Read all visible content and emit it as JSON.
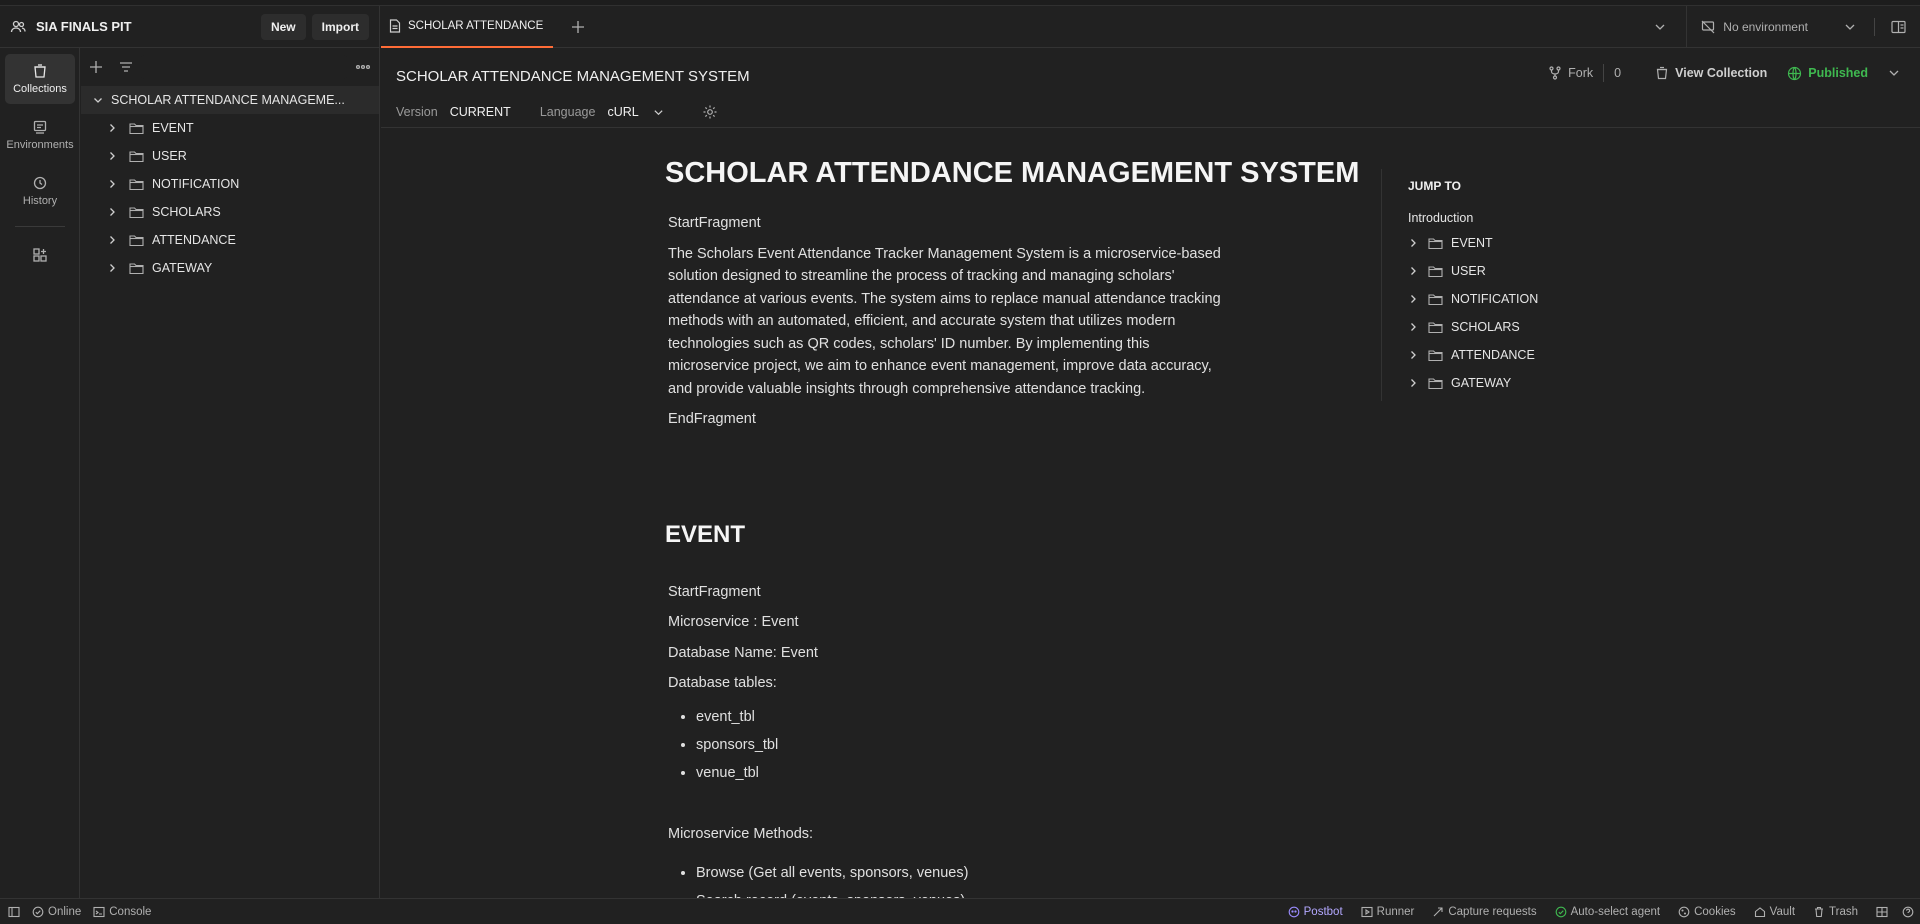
{
  "workspace": {
    "name": "SIA FINALS PIT",
    "new_label": "New",
    "import_label": "Import"
  },
  "rail": [
    {
      "label": "Collections",
      "icon": "collections-icon"
    },
    {
      "label": "Environments",
      "icon": "environments-icon"
    },
    {
      "label": "History",
      "icon": "history-icon"
    }
  ],
  "tree": {
    "root": "SCHOLAR ATTENDANCE MANAGEME...",
    "folders": [
      "EVENT",
      "USER",
      "NOTIFICATION",
      "SCHOLARS",
      "ATTENDANCE",
      "GATEWAY"
    ]
  },
  "tab": {
    "label": "SCHOLAR ATTENDANCE"
  },
  "environment": {
    "label": "No environment"
  },
  "collection": {
    "title": "SCHOLAR ATTENDANCE MANAGEMENT SYSTEM",
    "version_key": "Version",
    "version_value": "CURRENT",
    "language_key": "Language",
    "language_value": "cURL",
    "fork_label": "Fork",
    "fork_count": "0",
    "view_label": "View Collection",
    "published_label": "Published"
  },
  "doc": {
    "title": "SCHOLAR ATTENDANCE MANAGEMENT SYSTEM",
    "start1": "StartFragment",
    "intro": "The Scholars Event Attendance Tracker Management System is a microservice-based solution designed to streamline the process of tracking and managing scholars' attendance at various events. The system aims to replace manual attendance tracking methods with an automated, efficient, and accurate system that utilizes modern technologies such as QR codes, scholars' ID number. By implementing this microservice project, we aim to enhance event management, improve data accuracy, and provide valuable insights through comprehensive attendance tracking.",
    "end1": "EndFragment",
    "event_heading": "EVENT",
    "start2": "StartFragment",
    "microservice": "Microservice : Event",
    "dbname": "Database Name: Event",
    "tables_label": "Database tables:",
    "tables": [
      "event_tbl",
      "sponsors_tbl",
      "venue_tbl"
    ],
    "methods_label": "Microservice Methods:",
    "methods": [
      "Browse (Get all events, sponsors, venues)",
      "Search record (events, sponsors, venues)"
    ]
  },
  "jump": {
    "title": "JUMP TO",
    "intro": "Introduction",
    "items": [
      "EVENT",
      "USER",
      "NOTIFICATION",
      "SCHOLARS",
      "ATTENDANCE",
      "GATEWAY"
    ]
  },
  "status": {
    "online": "Online",
    "console": "Console",
    "postbot": "Postbot",
    "runner": "Runner",
    "capture": "Capture requests",
    "autoselect": "Auto-select agent",
    "cookies": "Cookies",
    "vault": "Vault",
    "trash": "Trash"
  },
  "colors": {
    "accent": "#ff6c37",
    "published": "#3fb950",
    "postbot": "#9b8cff",
    "online": "#3fb950"
  }
}
